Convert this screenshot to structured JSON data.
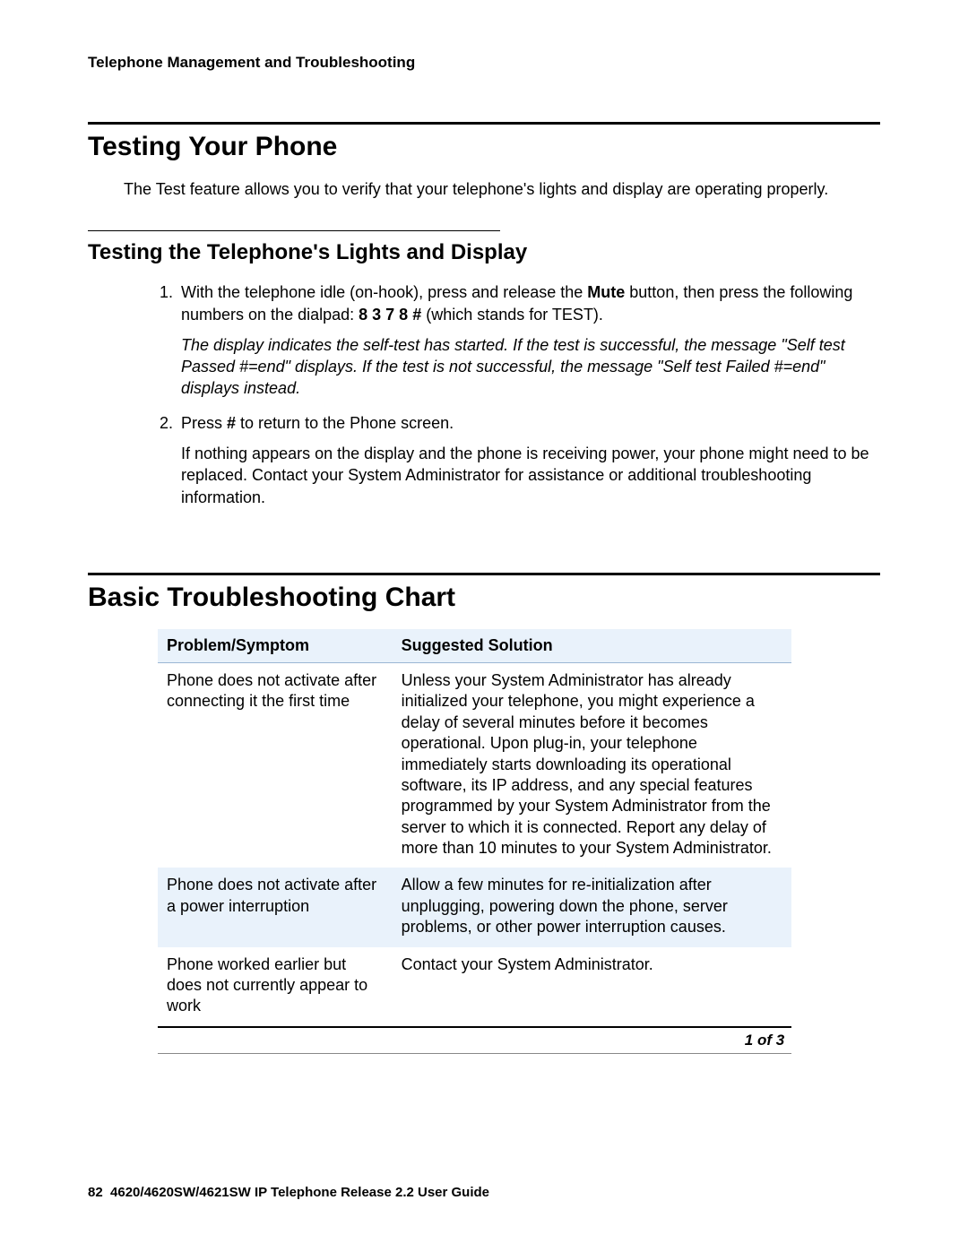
{
  "header": "Telephone Management and Troubleshooting",
  "section1": {
    "title": "Testing Your Phone",
    "intro": "The Test feature allows you to verify that your telephone's lights and display are operating properly."
  },
  "section1a": {
    "title": "Testing the Telephone's Lights and Display",
    "step1_prefix": "With the telephone idle (on-hook), press and release the ",
    "step1_mute": "Mute",
    "step1_mid": " button, then press the following numbers on the dialpad: ",
    "step1_code": "8 3 7 8 #",
    "step1_suffix": " (which stands for TEST).",
    "step1_note": "The display indicates the self-test has started. If the test is successful, the message \"Self test Passed #=end\" displays. If the test is not successful, the message \"Self test Failed #=end\" displays instead.",
    "step2_prefix": "Press ",
    "step2_hash": "#",
    "step2_suffix": " to return to the Phone screen.",
    "step2_note": "If nothing appears on the display and the phone is receiving power, your phone might need to be replaced. Contact your System Administrator for assistance or additional troubleshooting information."
  },
  "section2": {
    "title": "Basic Troubleshooting Chart",
    "col1": "Problem/Symptom",
    "col2": "Suggested Solution",
    "rows": [
      {
        "problem": "Phone does not activate after connecting it the first time",
        "solution": "Unless your System Administrator has already initialized your telephone, you might experience a delay of several minutes before it becomes operational. Upon plug-in, your telephone immediately starts downloading its operational software, its IP address, and any special features programmed by your System Administrator from the server to which it is connected. Report any delay of more than 10 minutes to your System Administrator."
      },
      {
        "problem": "Phone does not activate after a power interruption",
        "solution": "Allow a few minutes for re-initialization after unplugging, powering down the phone, server problems, or other power interruption causes."
      },
      {
        "problem": "Phone worked earlier but does not currently appear to work",
        "solution": "Contact your System Administrator."
      }
    ],
    "pager": "1 of 3"
  },
  "footer": {
    "page_number": "82",
    "doc_title": "4620/4620SW/4621SW IP Telephone Release 2.2 User Guide"
  }
}
